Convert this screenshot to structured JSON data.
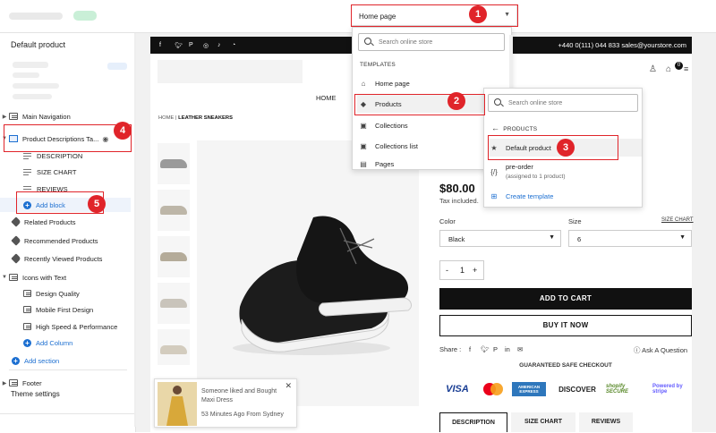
{
  "topbar": {
    "page_selector": "Home page"
  },
  "sidebar": {
    "title": "Default product",
    "items": [
      {
        "label": "Main Navigation"
      },
      {
        "label": "Product Descriptions Ta..."
      },
      {
        "label": "DESCRIPTION"
      },
      {
        "label": "SIZE CHART"
      },
      {
        "label": "REVIEWS"
      },
      {
        "label": "Add block"
      },
      {
        "label": "Related Products"
      },
      {
        "label": "Recommended Products"
      },
      {
        "label": "Recently Viewed Products"
      },
      {
        "label": "Icons with Text"
      },
      {
        "label": "Design Quality"
      },
      {
        "label": "Mobile First Design"
      },
      {
        "label": "High Speed & Performance"
      },
      {
        "label": "Add Column"
      },
      {
        "label": "Add section"
      },
      {
        "label": "Footer"
      }
    ],
    "theme_settings": "Theme settings"
  },
  "dropdown_templates": {
    "search_placeholder": "Search online store",
    "heading": "TEMPLATES",
    "items": [
      {
        "label": "Home page",
        "icon": "home-icon"
      },
      {
        "label": "Products",
        "icon": "tag-icon"
      },
      {
        "label": "Collections",
        "icon": "collections-icon"
      },
      {
        "label": "Collections list",
        "icon": "collections-list-icon"
      },
      {
        "label": "Pages",
        "icon": "page-icon"
      }
    ]
  },
  "dropdown_products": {
    "search_placeholder": "Search online store",
    "heading": "PRODUCTS",
    "default_item": "Default product",
    "preorder_item": "pre-order",
    "preorder_sub": "(assigned to 1 product)",
    "create_template": "Create template"
  },
  "store": {
    "contact": "+440 0(111) 044 833   sales@yourstore.com",
    "nav_home": "HOME",
    "cart_count": "0",
    "breadcrumb_home": "HOME",
    "breadcrumb_sep": "|",
    "breadcrumb_current": "LEATHER SNEAKERS",
    "price": "$80.00",
    "tax": "Tax included.",
    "color_label": "Color",
    "size_label": "Size",
    "size_chart_link": "SIZE CHART",
    "color_value": "Black",
    "size_value": "6",
    "qty_minus": "-",
    "qty_value": "1",
    "qty_plus": "+",
    "add_to_cart": "ADD TO CART",
    "buy_now": "BUY IT NOW",
    "share_label": "Share :",
    "ask_question": "Ask A Question",
    "guaranteed": "GUARANTEED SAFE CHECKOUT",
    "payments": [
      "VISA",
      "mastercard",
      "AMERICAN EXPRESS",
      "DISCOVER",
      "shopify SECURE",
      "Powered by stripe"
    ],
    "tabs": [
      "DESCRIPTION",
      "SIZE CHART",
      "REVIEWS"
    ]
  },
  "toast": {
    "message": "Someone liked and Bought Maxi Dress",
    "time": "53 Minutes Ago From Sydney"
  },
  "annotations": [
    "1",
    "2",
    "3",
    "4",
    "5"
  ],
  "colors": {
    "annotation": "#e0242a",
    "link": "#1c6fd1",
    "button_dark": "#111111"
  }
}
